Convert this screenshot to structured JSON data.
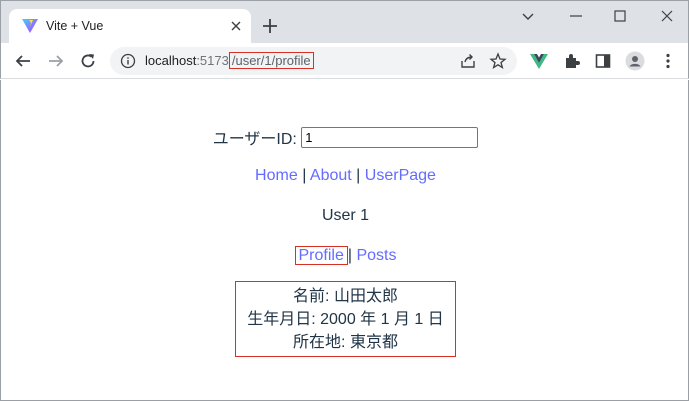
{
  "browser": {
    "tab_title": "Vite + Vue",
    "url_origin": "localhost",
    "url_port": ":5173",
    "url_path": "/user/1/profile"
  },
  "page": {
    "userid_label": "ユーザーID:",
    "userid_value": "1",
    "nav": {
      "home": "Home",
      "sep1": "|",
      "about": "About",
      "sep2": "|",
      "userpage": "UserPage"
    },
    "user_heading": "User 1",
    "subnav": {
      "profile": "Profile",
      "sep": "|",
      "posts": "Posts"
    },
    "profile": {
      "name": "名前: 山田太郎",
      "birthday": "生年月日: 2000 年 1 月 1 日",
      "location": "所在地: 東京都"
    }
  },
  "colors": {
    "link": "#646cff",
    "highlight_border": "#d93025"
  }
}
